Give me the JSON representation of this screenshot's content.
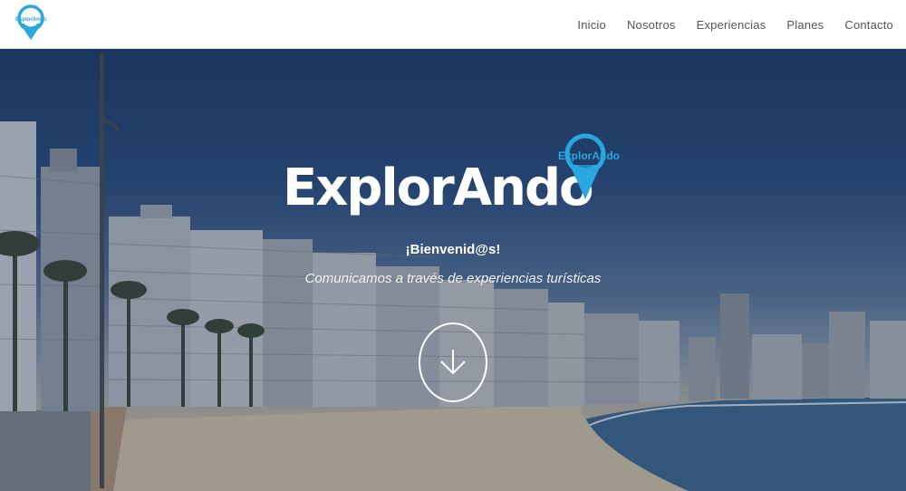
{
  "brand": {
    "logo_text": "ExplorAndo",
    "title": "ExplorAndo",
    "accent_color": "#29a8e0"
  },
  "nav": {
    "items": [
      {
        "label": "Inicio"
      },
      {
        "label": "Nosotros"
      },
      {
        "label": "Experiencias"
      },
      {
        "label": "Planes"
      },
      {
        "label": "Contacto"
      }
    ]
  },
  "hero": {
    "welcome": "¡Bienvenid@s!",
    "tagline": "Comunicamos a través de experiencias turísticas",
    "scroll_icon": "chevron-down-icon",
    "background": "beach-promenade-photo"
  }
}
